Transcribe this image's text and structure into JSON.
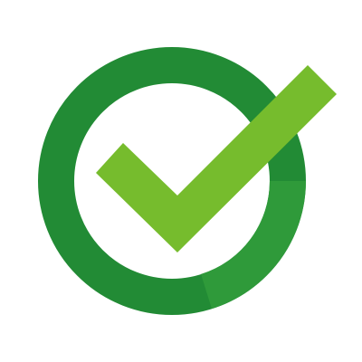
{
  "icon": {
    "name": "check-circle-icon",
    "ring_color": "#228B35",
    "ring_shade_color": "#2F9A3A",
    "check_color": "#76BC2D",
    "background_color": "#FFFFFF"
  }
}
